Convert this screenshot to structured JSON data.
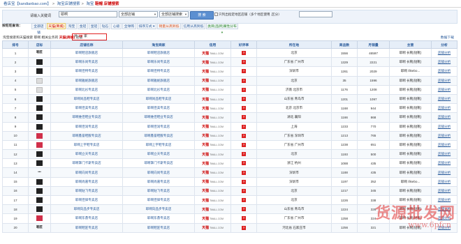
{
  "breadcrumb": [
    "看店宝【kandianbao.com】",
    "淘宝店铺搜索",
    "淘宝",
    "鞋帽 店铺搜索"
  ],
  "search": {
    "keyword_label": "请输入关键词",
    "keyword_value": "耶啊",
    "scope_select": "全部店铺",
    "type_select": "全部店铺搜索",
    "button_label": "搜 索",
    "region_checkbox_label": "只列出指定地区店铺（多个地区使用 ,区分）"
  },
  "tabs": {
    "label": "按旺旺查询：",
    "items": [
      "全部店铺",
      "天猫(商城)",
      "淘宝",
      "金冠",
      "皇冠",
      "钻石",
      "心级",
      "全球购",
      "排序方式 ▾",
      "销量从高到低",
      "信用从高到低",
      "类目(品牌)属性分布 ▾"
    ]
  },
  "summary": {
    "text_prefix": "淘宝搜索和天猫搜索 耶啊 相关业务的",
    "tmall": "天猫(商城)",
    "text_mid": "店铺",
    "box_prefix": "共",
    "count": "20",
    "box_suffix": "家",
    "export": "数据下载"
  },
  "table": {
    "headers": [
      "排号",
      "店标",
      "店铺名称",
      "淘宝商家",
      "信用",
      "好评率",
      "所在地",
      "商品数",
      "月销量",
      "主营",
      "分析"
    ],
    "badge_text": "天猫",
    "badge_sub": "TMALL.COM",
    "rate_text": "?",
    "action_text": "店铺分析",
    "rows": [
      {
        "n": "1",
        "logo": "text",
        "logo_text": "鞋匠",
        "name": "耶啊鞋店旗舰店",
        "seller": "耶啊鞋店旗舰店",
        "loc": "北京",
        "items": "1556",
        "sales": "46597",
        "main": "耶啊 长靴(短靴)"
      },
      {
        "n": "2",
        "logo": "dark",
        "logo_text": "",
        "name": "耶啊乐尚专卖店",
        "seller": "耶啊乐尚专卖店",
        "loc": "广东省 广州市",
        "items": "1329",
        "sales": "2221",
        "main": "耶啊 长靴(短靴)"
      },
      {
        "n": "3",
        "logo": "dark",
        "logo_text": "",
        "name": "耶啊佳特专卖店",
        "seller": "耶啊佳特专卖店",
        "loc": "深圳市",
        "items": "1261",
        "sales": "2029",
        "main": "耶啊 /likebo..."
      },
      {
        "n": "4",
        "logo": "light",
        "logo_text": "",
        "name": "耶啊雅妮旗舰店",
        "seller": "耶啊雅妮旗舰店",
        "loc": "北京",
        "items": "35",
        "sales": "1596",
        "main": "耶啊 长靴(短靴)"
      },
      {
        "n": "5",
        "logo": "light",
        "logo_text": "",
        "name": "耶啊北衫专卖店",
        "seller": "耶啊北衫专卖店",
        "loc": "济南 北京市",
        "items": "1176",
        "sales": "1208",
        "main": "耶啊 长靴(短靴)"
      },
      {
        "n": "6",
        "logo": "dark",
        "logo_text": "",
        "name": "耶啊尚品鞋专卖店",
        "seller": "耶啊尚品鞋专卖店",
        "loc": "山东省 青岛市",
        "items": "1201",
        "sales": "1097",
        "main": "耶啊 长靴(短靴)"
      },
      {
        "n": "7",
        "logo": "dark",
        "logo_text": "",
        "name": "耶啊佳美专卖店",
        "seller": "耶啊佳美专卖店",
        "loc": "北京 北京市",
        "items": "1168",
        "sales": "944",
        "main": "耶啊 长靴(短靴)"
      },
      {
        "n": "8",
        "logo": "dark",
        "logo_text": "",
        "name": "耶啊维佳鞋业专卖店",
        "seller": "耶啊维佳鞋业专卖店",
        "loc": "湖北 襄阳",
        "items": "1166",
        "sales": "868",
        "main": "耶啊 长靴(短靴)"
      },
      {
        "n": "9",
        "logo": "dark",
        "logo_text": "",
        "name": "耶啊佳润专卖店",
        "seller": "耶啊佳润专卖店",
        "loc": "上海",
        "items": "1233",
        "sales": "770",
        "main": "耶啊 长靴(短靴)"
      },
      {
        "n": "10",
        "logo": "red",
        "logo_text": "",
        "name": "耶啊鑫誉鞋服专卖店",
        "seller": "耶啊鑫誉鞋服专卖店",
        "loc": "广东省 深圳市",
        "items": "1213",
        "sales": "765",
        "main": "耶啊 长靴(短靴)"
      },
      {
        "n": "11",
        "logo": "red",
        "logo_text": "",
        "name": "耶啊上宇鞋专卖店",
        "seller": "耶啊上宇鞋专卖店",
        "loc": "广东省 广州市",
        "items": "1238",
        "sales": "651",
        "main": "耶啊 长靴(短靴)"
      },
      {
        "n": "12",
        "logo": "dark",
        "logo_text": "",
        "name": "耶啊立天专卖店",
        "seller": "耶啊立天专卖店",
        "loc": "北京",
        "items": "1193",
        "sales": "500",
        "main": "耶啊 长靴(短靴)"
      },
      {
        "n": "13",
        "logo": "dark",
        "logo_text": "",
        "name": "耶啊掌门卡斯专卖店",
        "seller": "耶啊掌门卡斯专卖店",
        "loc": "浙江 杭州",
        "items": "1088",
        "sales": "435",
        "main": "耶啊 长靴(短靴)"
      },
      {
        "n": "14",
        "logo": "text",
        "logo_text": "•••",
        "name": "耶啊向尚专卖店",
        "seller": "耶啊向尚专卖店",
        "loc": "深圳市",
        "items": "1188",
        "sales": "435",
        "main": "耶啊 长靴(短靴)"
      },
      {
        "n": "15",
        "logo": "dark",
        "logo_text": "",
        "name": "耶啊尚嘉专卖店",
        "seller": "耶啊尚嘉专卖店",
        "loc": "深圳市",
        "items": "1197",
        "sales": "352",
        "main": "耶啊 /likebo..."
      },
      {
        "n": "16",
        "logo": "dark",
        "logo_text": "",
        "name": "耶啊贴飞专卖店",
        "seller": "耶啊贴飞专卖店",
        "loc": "北京",
        "items": "1217",
        "sales": "345",
        "main": "耶啊 长靴(短靴)"
      },
      {
        "n": "17",
        "logo": "dark",
        "logo_text": "",
        "name": "耶啊佳锋专卖店",
        "seller": "耶啊佳锋专卖店",
        "loc": "北京",
        "items": "1226",
        "sales": "338",
        "main": "耶啊 长靴(短靴)"
      },
      {
        "n": "18",
        "logo": "dark",
        "logo_text": "",
        "name": "耶啊向品步专卖店",
        "seller": "耶啊向品步专卖店",
        "loc": "山东省 青岛市",
        "items": "1224",
        "sales": "326",
        "main": "耶啊 长靴(短靴)"
      },
      {
        "n": "19",
        "logo": "red",
        "logo_text": "",
        "name": "耶啊东鼎专卖店",
        "seller": "耶啊东鼎专卖店",
        "loc": "广东省 广州市",
        "items": "1258",
        "sales": "324",
        "main": "耶啊 长靴(短靴)"
      },
      {
        "n": "20",
        "logo": "text",
        "logo_text": "鞋匠",
        "name": "耶啊鞋匠专卖店",
        "seller": "耶啊鞋匠专卖店",
        "loc": "河北省 石家庄市",
        "items": "1256",
        "sales": "321",
        "main": "耶啊 长靴(短靴)"
      }
    ]
  },
  "watermark": {
    "line1": "货源批发网",
    "line2": "www.6pfcn"
  }
}
